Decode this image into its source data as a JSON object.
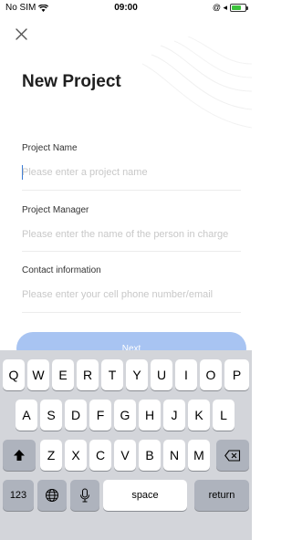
{
  "status_bar": {
    "carrier": "No SIM",
    "time": "09:00",
    "right_symbols": "@ ◂"
  },
  "form": {
    "title": "New Project",
    "fields": [
      {
        "label": "Project Name",
        "placeholder": "Please enter a project name"
      },
      {
        "label": "Project Manager",
        "placeholder": "Please enter the name of the person in charge"
      },
      {
        "label": "Contact information",
        "placeholder": "Please enter your cell phone number/email"
      }
    ],
    "next_label": "Next"
  },
  "keyboard": {
    "row1": [
      "Q",
      "W",
      "E",
      "R",
      "T",
      "Y",
      "U",
      "I",
      "O",
      "P"
    ],
    "row2": [
      "A",
      "S",
      "D",
      "F",
      "G",
      "H",
      "J",
      "K",
      "L"
    ],
    "row3": [
      "Z",
      "X",
      "C",
      "V",
      "B",
      "N",
      "M"
    ],
    "numbers_label": "123",
    "space_label": "space",
    "return_label": "return"
  }
}
